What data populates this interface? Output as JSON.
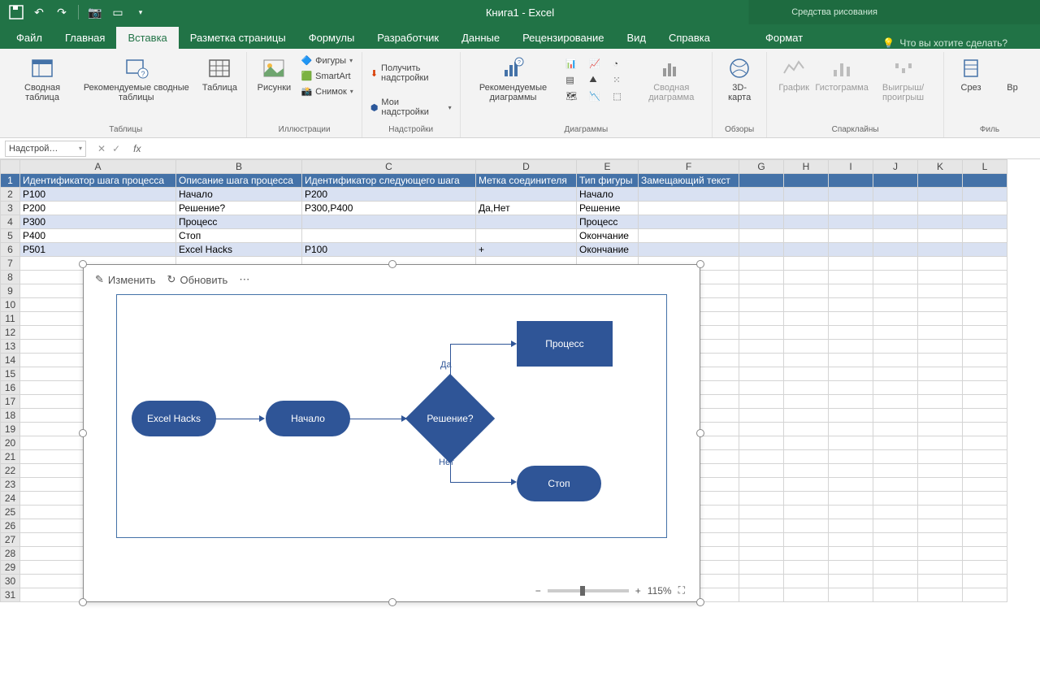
{
  "title": "Книга1 - Excel",
  "tools_context": "Средства рисования",
  "tabs": [
    "Файл",
    "Главная",
    "Вставка",
    "Разметка страницы",
    "Формулы",
    "Разработчик",
    "Данные",
    "Рецензирование",
    "Вид",
    "Справка"
  ],
  "active_tab": 2,
  "format_tab": "Формат",
  "tell_me": "Что вы хотите сделать?",
  "ribbon": {
    "tables": {
      "pivot": "Сводная таблица",
      "rec_pivot": "Рекомендуемые сводные таблицы",
      "table": "Таблица",
      "label": "Таблицы"
    },
    "illus": {
      "pictures": "Рисунки",
      "shapes": "Фигуры",
      "smartart": "SmartArt",
      "screenshot": "Снимок",
      "label": "Иллюстрации"
    },
    "addins": {
      "get": "Получить надстройки",
      "my": "Мои надстройки",
      "label": "Надстройки"
    },
    "charts": {
      "rec": "Рекомендуемые диаграммы",
      "pivotchart": "Сводная диаграмма",
      "label": "Диаграммы"
    },
    "tours": {
      "map": "3D-карта",
      "label": "Обзоры"
    },
    "spark": {
      "line": "График",
      "column": "Гистограмма",
      "winloss": "Выигрыш/проигрыш",
      "label": "Спарклайны"
    },
    "filters": {
      "slicer": "Срез",
      "timeline": "Вр",
      "label": "Филь"
    }
  },
  "namebox": "Надстрой…",
  "columns": [
    "A",
    "B",
    "C",
    "D",
    "E",
    "F",
    "G",
    "H",
    "I",
    "J",
    "K",
    "L"
  ],
  "header_cells": [
    "Идентификатор шага процесса",
    "Описание шага процесса",
    "Идентификатор следующего шага",
    "Метка соединителя",
    "Тип фигуры",
    "Замещающий текст"
  ],
  "rows": [
    {
      "n": 2,
      "cells": [
        "P100",
        "Начало",
        "P200",
        "",
        "Начало",
        ""
      ]
    },
    {
      "n": 3,
      "cells": [
        "P200",
        "Решение?",
        "P300,P400",
        "Да,Нет",
        "Решение",
        ""
      ]
    },
    {
      "n": 4,
      "cells": [
        "P300",
        "Процесс",
        "",
        "",
        "Процесс",
        ""
      ]
    },
    {
      "n": 5,
      "cells": [
        "P400",
        "Стоп",
        "",
        "",
        "Окончание",
        ""
      ]
    },
    {
      "n": 6,
      "cells": [
        "P501",
        "Excel Hacks",
        "P100",
        "+",
        "Окончание",
        ""
      ]
    }
  ],
  "addin": {
    "edit": "Изменить",
    "refresh": "Обновить",
    "shapes": {
      "excelhacks": "Excel Hacks",
      "start": "Начало",
      "decision": "Решение?",
      "process": "Процесс",
      "stop": "Стоп"
    },
    "labels": {
      "yes": "Да",
      "no": "Нет"
    },
    "zoom": "115%"
  }
}
